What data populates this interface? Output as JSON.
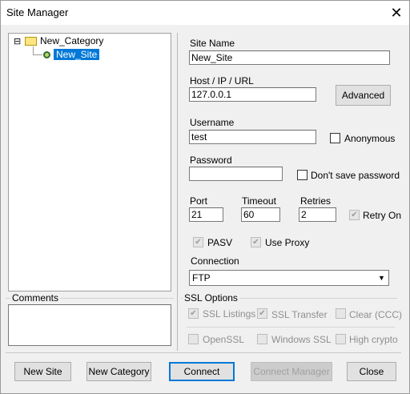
{
  "window": {
    "title": "Site Manager",
    "close_glyph": "✕"
  },
  "tree": {
    "expander": "⊟",
    "category": "New_Category",
    "site": "New_Site"
  },
  "comments": {
    "label": "Comments",
    "value": ""
  },
  "form": {
    "site_name_label": "Site Name",
    "site_name_value": "New_Site",
    "host_label": "Host / IP / URL",
    "host_value": "127.0.0.1",
    "advanced_label": "Advanced",
    "username_label": "Username",
    "username_value": "test",
    "anonymous_label": "Anonymous",
    "password_label": "Password",
    "password_value": "",
    "dont_save_label": "Don't save password",
    "port_label": "Port",
    "port_value": "21",
    "timeout_label": "Timeout",
    "timeout_value": "60",
    "retries_label": "Retries",
    "retries_value": "2",
    "retry_on_label": "Retry On",
    "pasv_label": "PASV",
    "use_proxy_label": "Use Proxy",
    "connection_label": "Connection",
    "connection_value": "FTP"
  },
  "ssl": {
    "group_label": "SSL Options",
    "listings_label": "SSL Listings",
    "transfer_label": "SSL Transfer",
    "clear_label": "Clear (CCC)",
    "openssl_label": "OpenSSL",
    "windows_ssl_label": "Windows SSL",
    "high_crypto_label": "High crypto"
  },
  "buttons": {
    "new_site": "New Site",
    "new_category": "New Category",
    "connect": "Connect",
    "connect_manager": "Connect Manager",
    "close": "Close"
  },
  "colors": {
    "selection": "#0078d7",
    "window_bg": "#f0f0f0"
  }
}
